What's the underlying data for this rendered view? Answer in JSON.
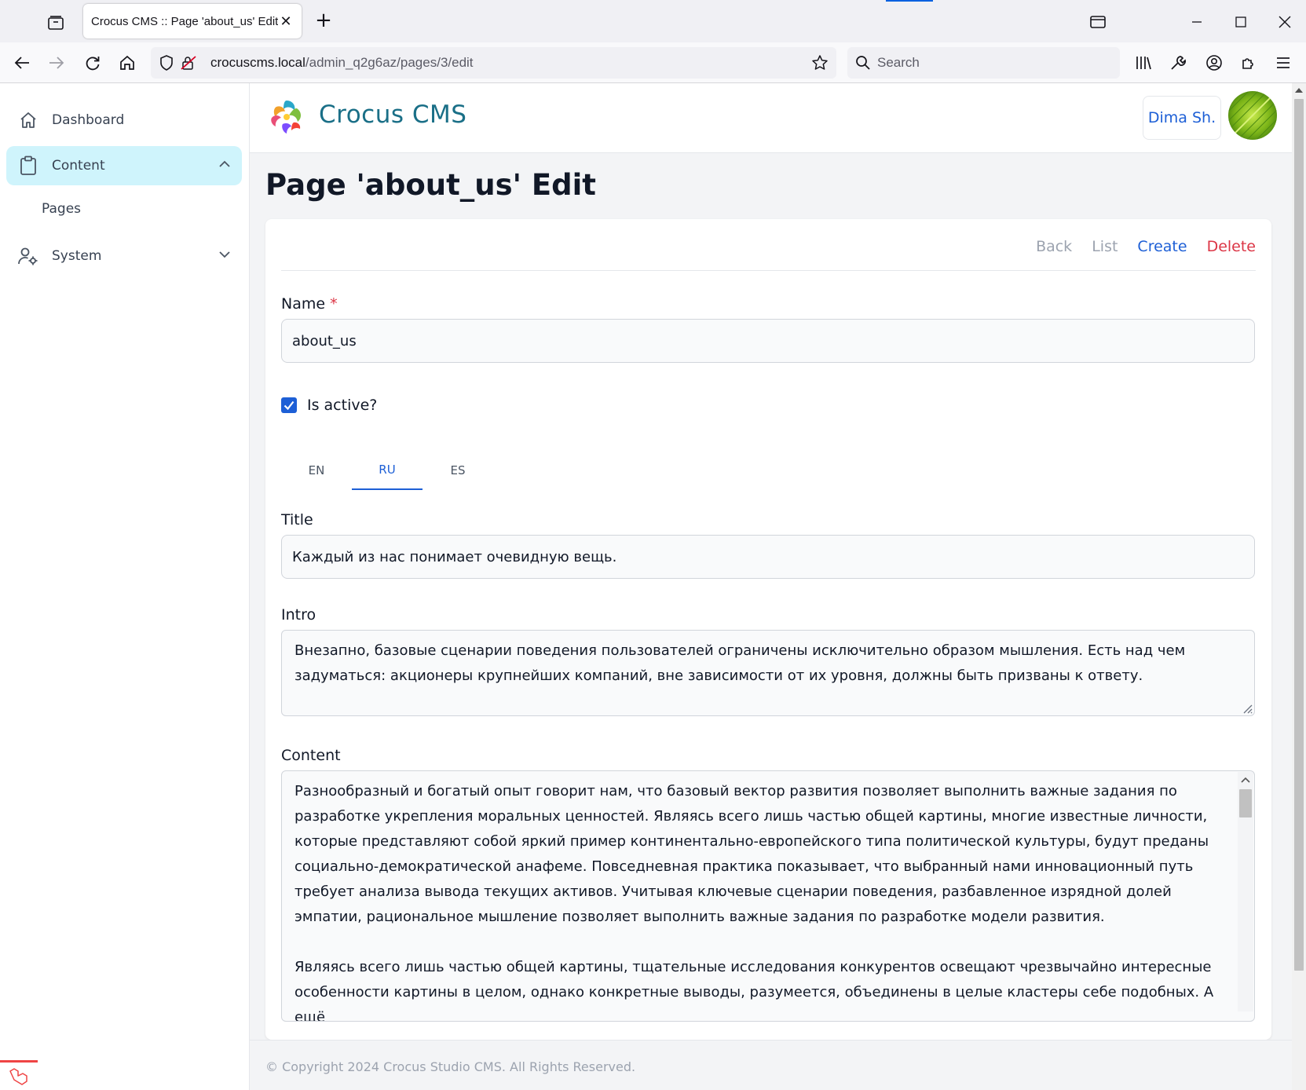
{
  "browser": {
    "tab_title": "Crocus CMS :: Page 'about_us' Edit",
    "url_host": "crocuscms.local",
    "url_path": "/admin_q2g6az/pages/3/edit",
    "search_placeholder": "Search"
  },
  "sidebar": {
    "items": [
      {
        "label": "Dashboard",
        "icon": "home-icon"
      },
      {
        "label": "Content",
        "icon": "clipboard-icon",
        "expanded": true
      },
      {
        "label": "Pages"
      },
      {
        "label": "System",
        "icon": "user-gear-icon",
        "expanded": false
      }
    ]
  },
  "header": {
    "brand": "Crocus CMS",
    "user_name": "Dima Sh."
  },
  "page": {
    "title": "Page 'about_us' Edit"
  },
  "actions": {
    "back": "Back",
    "list": "List",
    "create": "Create",
    "delete": "Delete"
  },
  "form": {
    "name_label": "Name",
    "required_mark": "*",
    "name_value": "about_us",
    "is_active_label": "Is active?",
    "is_active": true,
    "lang_tabs": [
      "EN",
      "RU",
      "ES"
    ],
    "active_lang": "RU",
    "title_label": "Title",
    "title_value": "Каждый из нас понимает очевидную вещь.",
    "intro_label": "Intro",
    "intro_value": "Внезапно, базовые сценарии поведения пользователей ограничены исключительно образом мышления. Есть над чем задуматься: акционеры крупнейших компаний, вне зависимости от их уровня, должны быть призваны к ответу.",
    "content_label": "Content",
    "content_p1": "Разнообразный и богатый опыт говорит нам, что базовый вектор развития позволяет выполнить важные задания по разработке укрепления моральных ценностей. Являясь всего лишь частью общей картины, многие известные личности, которые представляют собой яркий пример континентально-европейского типа политической культуры, будут преданы социально-демократической анафеме. Повседневная практика показывает, что выбранный нами инновационный путь требует анализа вывода текущих активов. Учитывая ключевые сценарии поведения, разбавленное изрядной долей эмпатии, рациональное мышление позволяет выполнить важные задания по разработке модели развития.",
    "content_p2": "Являясь всего лишь частью общей картины, тщательные исследования конкурентов освещают чрезвычайно интересные особенности картины в целом, однако конкретные выводы, разумеется, объединены в целые кластеры себе подобных. А ещё"
  },
  "footer": {
    "copyright": "© Copyright 2024 Crocus Studio CMS. All Rights Reserved."
  },
  "colors": {
    "accent": "#1d5fd6",
    "danger": "#dc3545",
    "sidebar_active": "#cff4fc",
    "brand": "#1a6f87"
  }
}
